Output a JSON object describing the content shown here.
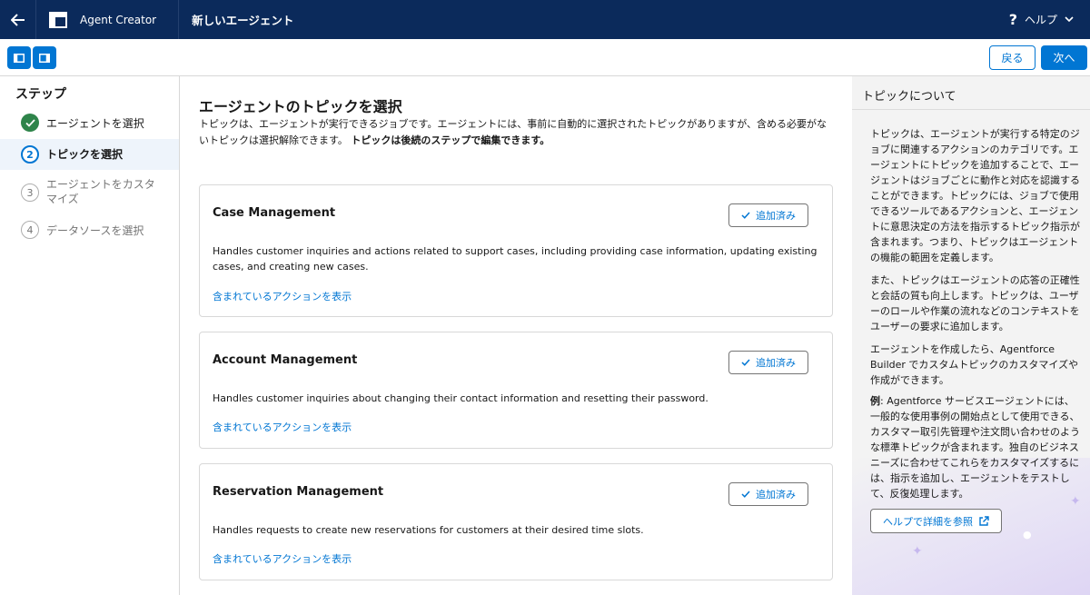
{
  "header": {
    "back_icon": "arrow-left-icon",
    "app_icon": "app-layout-icon",
    "app_title": "Agent Creator",
    "page_title": "新しいエージェント",
    "help_label": "ヘルプ",
    "help_icon": "question-icon"
  },
  "toolbar": {
    "left_panel_icon": "panel-left-icon",
    "right_panel_icon": "panel-right-icon",
    "back_label": "戻る",
    "next_label": "次へ"
  },
  "steps": {
    "title": "ステップ",
    "items": [
      {
        "number": "",
        "label": "エージェントを選択",
        "state": "done"
      },
      {
        "number": "2",
        "label": "トピックを選択",
        "state": "active"
      },
      {
        "number": "3",
        "label": "エージェントをカスタマイズ",
        "state": "todo"
      },
      {
        "number": "4",
        "label": "データソースを選択",
        "state": "todo"
      }
    ]
  },
  "main": {
    "title": "エージェントのトピックを選択",
    "desc_normal": "トピックは、エージェントが実行できるジョブです。エージェントには、事前に自動的に選択されたトピックがありますが、含める必要がないトピックは選択解除できます。",
    "desc_bold": "トピックは後続のステップで編集できます。",
    "cards": [
      {
        "title": "Case Management",
        "added_label": "追加済み",
        "description": "Handles customer inquiries and actions related to support cases, including providing case information, updating existing cases, and creating new cases.",
        "link": "含まれているアクションを表示"
      },
      {
        "title": "Account Management",
        "added_label": "追加済み",
        "description": "Handles customer inquiries about changing their contact information and resetting their password.",
        "link": "含まれているアクションを表示"
      },
      {
        "title": "Reservation Management",
        "added_label": "追加済み",
        "description": "Handles requests to create new reservations for customers at their desired time slots.",
        "link": "含まれているアクションを表示"
      }
    ]
  },
  "right_panel": {
    "title": "トピックについて",
    "p1": "トピックは、エージェントが実行する特定のジョブに関連するアクションのカテゴリです。エージェントにトピックを追加することで、エージェントはジョブごとに動作と対応を認識することができます。トピックには、ジョブで使用できるツールであるアクションと、エージェントに意思決定の方法を指示するトピック指示が含まれます。つまり、トピックはエージェントの機能の範囲を定義します。",
    "p2": "また、トピックはエージェントの応答の正確性と会話の質も向上します。トピックは、ユーザーのロールや作業の流れなどのコンテキストをユーザーの要求に追加します。",
    "p3": "エージェントを作成したら、Agentforce Builder でカスタムトピックのカスタマイズや作成ができます。",
    "p4_bold": "例",
    "p4": ": Agentforce サービスエージェントには、一般的な使用事例の開始点として使用できる、カスタマー取引先管理や注文問い合わせのような標準トピックが含まれます。独自のビジネスニーズに合わせてこれらをカスタマイズするには、指示を追加し、エージェントをテストして、反復処理します。",
    "help_button": "ヘルプで詳細を参照"
  }
}
